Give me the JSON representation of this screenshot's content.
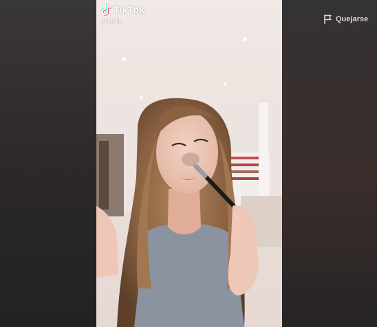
{
  "brand": {
    "name": "TikTok",
    "logo_icon": "tiktok-note-icon",
    "handle": "@thalia"
  },
  "actions": {
    "report_label": "Quejarse",
    "report_icon": "flag-icon"
  },
  "colors": {
    "background": "#2b2b2b",
    "brand_text": "#ffffff",
    "accent_cyan": "#25f4ee",
    "accent_red": "#fe2c55"
  }
}
